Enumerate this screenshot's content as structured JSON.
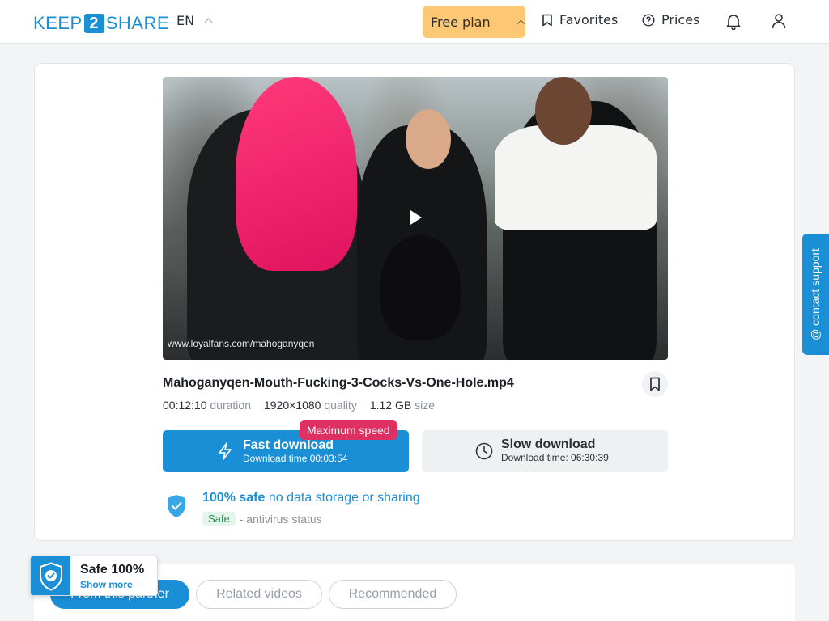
{
  "header": {
    "logo_left": "KEEP",
    "logo_number": "2",
    "logo_right": "SHARE",
    "language": "EN",
    "plan_label": "Free plan",
    "favorites_label": "Favorites",
    "prices_label": "Prices"
  },
  "video": {
    "watermark": "www.loyalfans.com/mahoganyqen"
  },
  "file": {
    "name": "Mahoganyqen-Mouth-Fucking-3-Cocks-Vs-One-Hole.mp4",
    "duration_value": "00:12:10",
    "duration_label": "duration",
    "quality_value": "1920×1080",
    "quality_label": "quality",
    "size_value": "1.12 GB",
    "size_label": "size"
  },
  "download": {
    "fast_label": "Fast download",
    "fast_time": "Download time 00:03:54",
    "max_speed_badge": "Maximum speed",
    "slow_label": "Slow download",
    "slow_time": "Download time: 06:30:39"
  },
  "safety": {
    "strong": "100% safe",
    "rest": "no data storage or sharing",
    "pill": "Safe",
    "status": "- antivirus status"
  },
  "support": {
    "label": "@ contact support"
  },
  "tabs": [
    {
      "label": "From this partner"
    },
    {
      "label": "Related videos"
    },
    {
      "label": "Recommended"
    }
  ],
  "safe_badge": {
    "title": "Safe 100%",
    "link": "Show more"
  },
  "colors": {
    "accent": "#1a8fd6",
    "plan": "#fcc874",
    "badge_pink": "#e02f63"
  }
}
